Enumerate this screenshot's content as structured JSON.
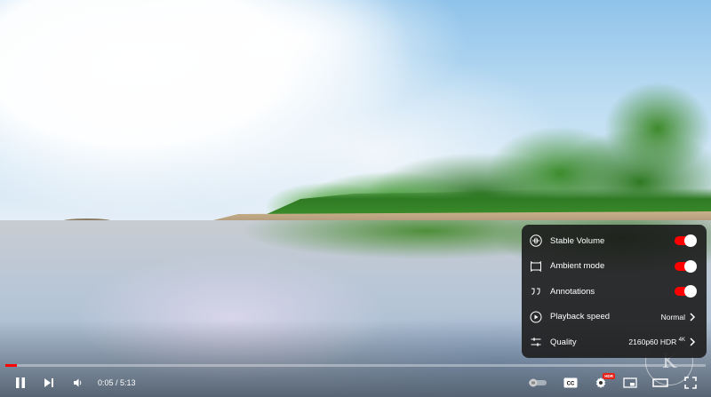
{
  "settings_menu": {
    "items": [
      {
        "label": "Stable Volume",
        "icon": "stable-volume-icon",
        "toggle_on": true
      },
      {
        "label": "Ambient mode",
        "icon": "ambient-mode-icon",
        "toggle_on": true
      },
      {
        "label": "Annotations",
        "icon": "annotations-icon",
        "toggle_on": true
      },
      {
        "label": "Playback speed",
        "icon": "playback-speed-icon",
        "value": "Normal"
      },
      {
        "label": "Quality",
        "icon": "quality-sliders-icon",
        "value": "2160p60 HDR",
        "value_sup": "4K"
      }
    ]
  },
  "player": {
    "current_time": "0:05",
    "duration": "5:13",
    "time_display": "0:05 / 5:13",
    "progress_fraction": 0.016,
    "hdr_badge": "HDR",
    "watermark_letter": "K"
  },
  "colors": {
    "accent_red": "#ff0000",
    "menu_background": "#1c1c1c",
    "toggle_on": "#ff0000"
  }
}
